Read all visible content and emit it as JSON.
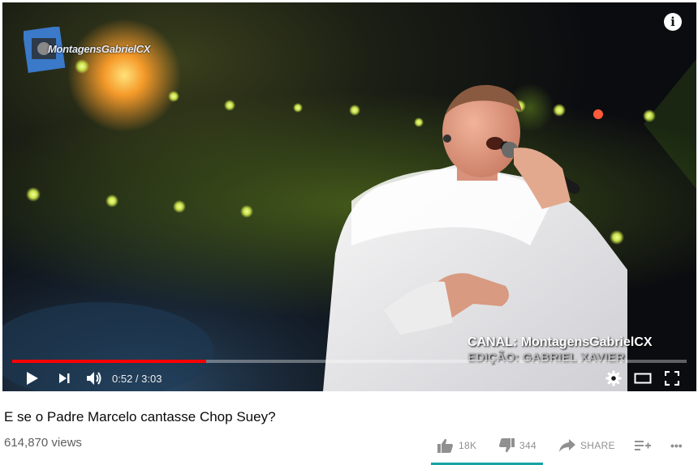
{
  "player": {
    "logo_text": "MontagensGabrielCX",
    "caption_channel": "CANAL: MontagensGabrielCX",
    "caption_edit": "EDIÇÃO: GABRIEL XAVIER",
    "info_glyph": "i",
    "time_current": "0:52",
    "time_separator": " / ",
    "time_total": "3:03",
    "progress_fraction": 0.288,
    "accent_color": "#ff0000"
  },
  "video": {
    "title": "E se o Padre Marcelo cantasse Chop Suey?",
    "views": "614,870 views"
  },
  "actions": {
    "likes": "18K",
    "dislikes": "344",
    "share": "SHARE",
    "more": "•••"
  },
  "icons": [
    "play-icon",
    "next-icon",
    "volume-icon",
    "settings-icon",
    "theater-icon",
    "fullscreen-icon",
    "thumbs-up-icon",
    "thumbs-down-icon",
    "share-icon",
    "add-to-playlist-icon",
    "more-icon",
    "info-icon"
  ]
}
